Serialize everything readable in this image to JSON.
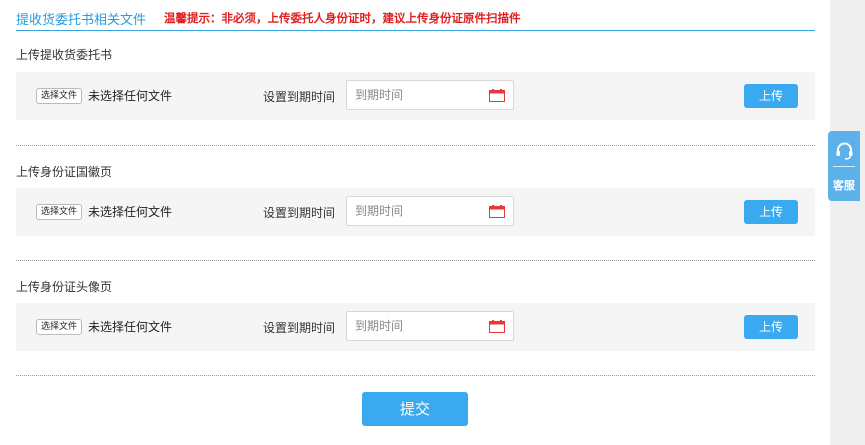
{
  "header": {
    "title": "提收货委托书相关文件",
    "hint": "温馨提示：非必须，上传委托人身份证时，建议上传身份证原件扫描件"
  },
  "sections": [
    {
      "title": "上传提收货委托书",
      "file_button": "选择文件",
      "file_status": "未选择任何文件",
      "expire_label": "设置到期时间",
      "date_placeholder": "到期时间",
      "upload_label": "上传"
    },
    {
      "title": "上传身份证国徽页",
      "file_button": "选择文件",
      "file_status": "未选择任何文件",
      "expire_label": "设置到期时间",
      "date_placeholder": "到期时间",
      "upload_label": "上传"
    },
    {
      "title": "上传身份证头像页",
      "file_button": "选择文件",
      "file_status": "未选择任何文件",
      "expire_label": "设置到期时间",
      "date_placeholder": "到期时间",
      "upload_label": "上传"
    }
  ],
  "submit_label": "提交",
  "customer_service": {
    "label": "客服",
    "icon": "headset-icon"
  },
  "colors": {
    "accent": "#3aaaf0",
    "header_title": "#2b9be0",
    "warning": "#e02020",
    "calendar": "#e8383d",
    "service_tab": "#5cb1ea"
  }
}
